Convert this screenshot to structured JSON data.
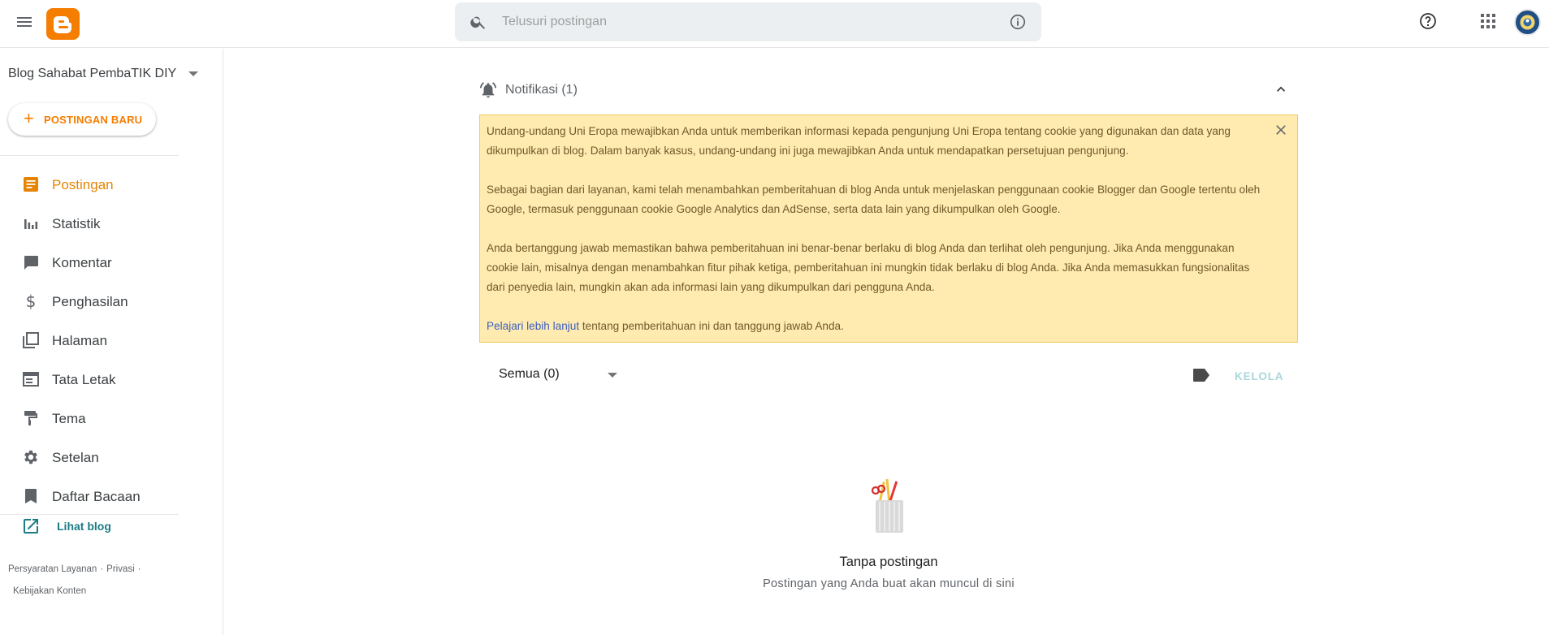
{
  "header": {
    "search_placeholder": "Telusuri postingan",
    "icons": [
      "menu-icon",
      "blogger-logo",
      "search-icon",
      "info-icon",
      "help-icon",
      "apps-icon",
      "avatar"
    ],
    "accent_color": "#f57d00"
  },
  "sidebar": {
    "blog_name": "Blog Sahabat PembaTIK DIY",
    "new_post_label": "POSTINGAN BARU",
    "items": [
      {
        "label": "Postingan",
        "icon": "posts-icon",
        "active": true
      },
      {
        "label": "Statistik",
        "icon": "stats-icon",
        "active": false
      },
      {
        "label": "Komentar",
        "icon": "comment-icon",
        "active": false
      },
      {
        "label": "Penghasilan",
        "icon": "dollar-icon",
        "active": false
      },
      {
        "label": "Halaman",
        "icon": "pages-icon",
        "active": false
      },
      {
        "label": "Tata Letak",
        "icon": "layout-icon",
        "active": false
      },
      {
        "label": "Tema",
        "icon": "theme-icon",
        "active": false
      },
      {
        "label": "Setelan",
        "icon": "gear-icon",
        "active": false
      },
      {
        "label": "Daftar Bacaan",
        "icon": "bookmark-icon",
        "active": false
      }
    ],
    "view_blog_label": "Lihat blog",
    "footer": {
      "terms": "Persyaratan Layanan",
      "privacy": "Privasi",
      "content_policy": "Kebijakan Konten"
    }
  },
  "notifications": {
    "title": "Notifikasi (1)",
    "paragraphs": [
      "Undang-undang Uni Eropa mewajibkan Anda untuk memberikan informasi kepada pengunjung Uni Eropa tentang cookie yang digunakan dan data yang dikumpulkan di blog. Dalam banyak kasus, undang-undang ini juga mewajibkan Anda untuk mendapatkan persetujuan pengunjung.",
      "Sebagai bagian dari layanan, kami telah menambahkan pemberitahuan di blog Anda untuk menjelaskan penggunaan cookie Blogger dan Google tertentu oleh Google, termasuk penggunaan cookie Google Analytics dan AdSense, serta data lain yang dikumpulkan oleh Google.",
      "Anda bertanggung jawab memastikan bahwa pemberitahuan ini benar-benar berlaku di blog Anda dan terlihat oleh pengunjung. Jika Anda menggunakan cookie lain, misalnya dengan menambahkan fitur pihak ketiga, pemberitahuan ini mungkin tidak berlaku di blog Anda. Jika Anda memasukkan fungsionalitas dari penyedia lain, mungkin akan ada informasi lain yang dikumpulkan dari pengguna Anda."
    ],
    "learn_more_link": "Pelajari lebih lanjut",
    "learn_more_tail": " tentang pemberitahuan ini dan tanggung jawab Anda.",
    "background_color": "#ffeab0"
  },
  "posts": {
    "filter_label": "Semua (0)",
    "manage_label": "KELOLA",
    "empty_title": "Tanpa postingan",
    "empty_subtitle": "Postingan yang Anda buat akan muncul di sini"
  }
}
